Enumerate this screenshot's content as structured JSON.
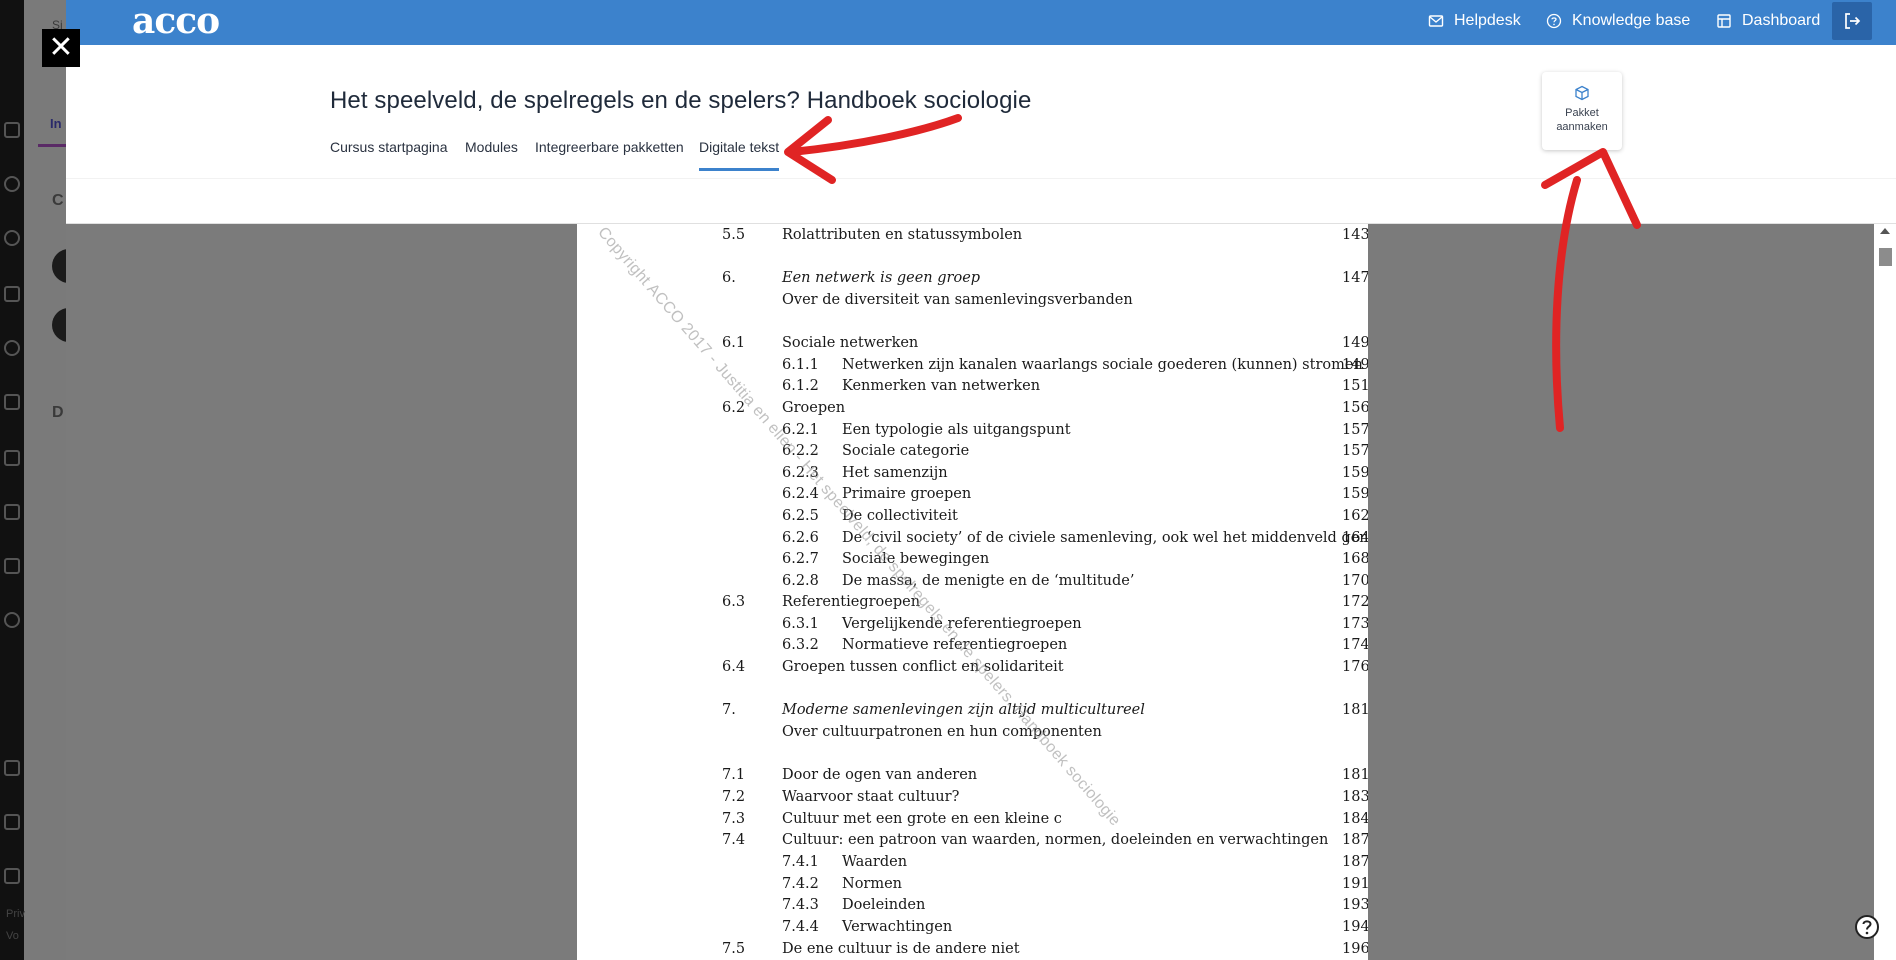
{
  "background_app": {
    "bg_texts": [
      "Si",
      "In",
      "C",
      "D"
    ],
    "bg_footer": [
      "Priv",
      "Vo"
    ]
  },
  "close_button": {
    "label": "✕"
  },
  "topbar": {
    "logo": "acco",
    "helpdesk": "Helpdesk",
    "knowledge_base": "Knowledge base",
    "dashboard": "Dashboard",
    "color": "#3c82cc"
  },
  "header": {
    "title": "Het speelveld, de spelregels en de spelers? Handboek sociologie",
    "tabs": [
      "Cursus startpagina",
      "Modules",
      "Integreerbare pakketten",
      "Digitale tekst"
    ],
    "active_tab": "Digitale tekst",
    "create_package_line1": "Pakket",
    "create_package_line2": "aanmaken"
  },
  "document": {
    "watermark": "Copyright ACCO 2017 - Justitia en elien - Het speelveld, de spelregels en de spelers. Handboek sociologie",
    "toc": [
      {
        "num": "5.5",
        "sub": "",
        "title": "Rolattributen en statussymbolen",
        "page": "143",
        "italic": false
      },
      {
        "num": "6.",
        "sub": "",
        "title": "Een netwerk is geen groep",
        "page": "147",
        "italic": true
      },
      {
        "num": "",
        "sub": "",
        "title": "Over de diversiteit van samenlevingsverbanden",
        "page": "",
        "italic": false
      },
      {
        "num": "6.1",
        "sub": "",
        "title": "Sociale netwerken",
        "page": "149",
        "italic": false
      },
      {
        "num": "",
        "sub": "6.1.1",
        "title": "Netwerken zijn kanalen waarlangs sociale goederen (kunnen) stromen",
        "page": "149",
        "italic": false
      },
      {
        "num": "",
        "sub": "6.1.2",
        "title": "Kenmerken van netwerken",
        "page": "151",
        "italic": false
      },
      {
        "num": "6.2",
        "sub": "",
        "title": "Groepen",
        "page": "156",
        "italic": false
      },
      {
        "num": "",
        "sub": "6.2.1",
        "title": "Een typologie als uitgangspunt",
        "page": "157",
        "italic": false
      },
      {
        "num": "",
        "sub": "6.2.2",
        "title": "Sociale categorie",
        "page": "157",
        "italic": false
      },
      {
        "num": "",
        "sub": "6.2.3",
        "title": "Het samenzijn",
        "page": "159",
        "italic": false
      },
      {
        "num": "",
        "sub": "6.2.4",
        "title": "Primaire groepen",
        "page": "159",
        "italic": false
      },
      {
        "num": "",
        "sub": "6.2.5",
        "title": "De collectiviteit",
        "page": "162",
        "italic": false
      },
      {
        "num": "",
        "sub": "6.2.6",
        "title": "De ‘civil society’ of de civiele samenleving, ook wel het middenveld genoemd",
        "page": "164",
        "italic": false
      },
      {
        "num": "",
        "sub": "6.2.7",
        "title": "Sociale bewegingen",
        "page": "168",
        "italic": false
      },
      {
        "num": "",
        "sub": "6.2.8",
        "title": "De massa, de menigte en de ‘multitude’",
        "page": "170",
        "italic": false
      },
      {
        "num": "6.3",
        "sub": "",
        "title": "Referentiegroepen",
        "page": "172",
        "italic": false
      },
      {
        "num": "",
        "sub": "6.3.1",
        "title": "Vergelijkende referentiegroepen",
        "page": "173",
        "italic": false
      },
      {
        "num": "",
        "sub": "6.3.2",
        "title": "Normatieve referentiegroepen",
        "page": "174",
        "italic": false
      },
      {
        "num": "6.4",
        "sub": "",
        "title": "Groepen tussen conflict en solidariteit",
        "page": "176",
        "italic": false
      },
      {
        "num": "7.",
        "sub": "",
        "title": "Moderne samenlevingen zijn altijd multicultureel",
        "page": "181",
        "italic": true
      },
      {
        "num": "",
        "sub": "",
        "title": "Over cultuurpatronen en hun componenten",
        "page": "",
        "italic": false
      },
      {
        "num": "7.1",
        "sub": "",
        "title": "Door de ogen van anderen",
        "page": "181",
        "italic": false
      },
      {
        "num": "7.2",
        "sub": "",
        "title": "Waarvoor staat cultuur?",
        "page": "183",
        "italic": false
      },
      {
        "num": "7.3",
        "sub": "",
        "title": "Cultuur met een grote en een kleine c",
        "page": "184",
        "italic": false
      },
      {
        "num": "7.4",
        "sub": "",
        "title": "Cultuur: een patroon van waarden, normen, doeleinden en verwachtingen",
        "page": "187",
        "italic": false
      },
      {
        "num": "",
        "sub": "7.4.1",
        "title": "Waarden",
        "page": "187",
        "italic": false
      },
      {
        "num": "",
        "sub": "7.4.2",
        "title": "Normen",
        "page": "191",
        "italic": false
      },
      {
        "num": "",
        "sub": "7.4.3",
        "title": "Doeleinden",
        "page": "193",
        "italic": false
      },
      {
        "num": "",
        "sub": "7.4.4",
        "title": "Verwachtingen",
        "page": "194",
        "italic": false
      },
      {
        "num": "7.5",
        "sub": "",
        "title": "De ene cultuur is de andere niet",
        "page": "196",
        "italic": false
      }
    ]
  },
  "annotation_color": "#e02424"
}
